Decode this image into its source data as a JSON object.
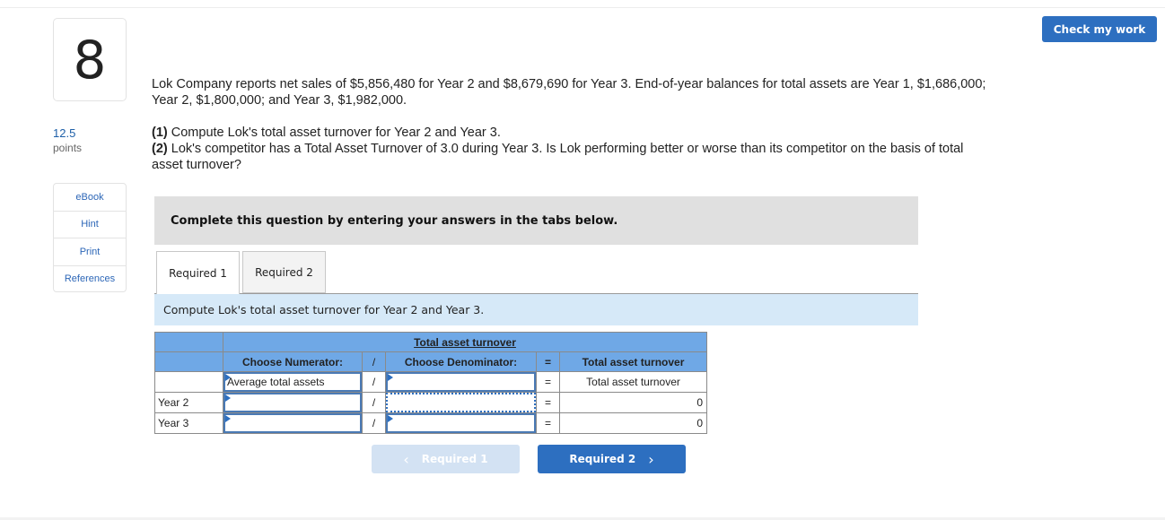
{
  "question": {
    "number": "8",
    "points_value": "12.5",
    "points_label": "points"
  },
  "sidebar": {
    "links": [
      {
        "label": "eBook",
        "icon": "book"
      },
      {
        "label": "Hint",
        "icon": "lightbulb"
      },
      {
        "label": "Print",
        "icon": "printer"
      },
      {
        "label": "References",
        "icon": "references"
      }
    ]
  },
  "header": {
    "check_button": "Check my work"
  },
  "problem": {
    "intro": "Lok Company reports net sales of $5,856,480 for Year 2 and $8,679,690 for Year 3. End-of-year balances for total assets are Year 1, $1,686,000; Year 2, $1,800,000; and Year 3, $1,982,000.",
    "part1_label": "(1)",
    "part1_text": " Compute Lok's total asset turnover for Year 2 and Year 3.",
    "part2_label": "(2)",
    "part2_text": " Lok's competitor has a Total Asset Turnover of 3.0 during Year 3. Is Lok performing better or worse than its competitor on the basis of total asset turnover?"
  },
  "instructions": "Complete this question by entering your answers in the tabs below.",
  "tabs": [
    {
      "label": "Required 1",
      "active": true
    },
    {
      "label": "Required 2",
      "active": false
    }
  ],
  "required1": {
    "description": "Compute Lok's total asset turnover for Year 2 and Year 3.",
    "table": {
      "title": "Total asset turnover",
      "headers": {
        "numerator": "Choose Numerator:",
        "divide": "/",
        "denominator": "Choose Denominator:",
        "equals": "=",
        "result": "Total asset turnover"
      },
      "rows": [
        {
          "label": "",
          "numerator": "Average total assets",
          "divide": "/",
          "denominator": "",
          "equals": "=",
          "result": "Total asset turnover"
        },
        {
          "label": "Year 2",
          "numerator": "",
          "divide": "/",
          "denominator": "",
          "equals": "=",
          "result": "0"
        },
        {
          "label": "Year 3",
          "numerator": "",
          "divide": "/",
          "denominator": "",
          "equals": "=",
          "result": "0"
        }
      ]
    }
  },
  "navigation": {
    "prev_label": "Required 1",
    "prev_icon": "‹",
    "next_label": "Required 2",
    "next_icon": "›"
  },
  "colors": {
    "accent": "#2d6fc0",
    "table_header": "#6fa8e6",
    "description_bg": "#d6e9f8",
    "instructions_bg": "#e0e0e0"
  }
}
